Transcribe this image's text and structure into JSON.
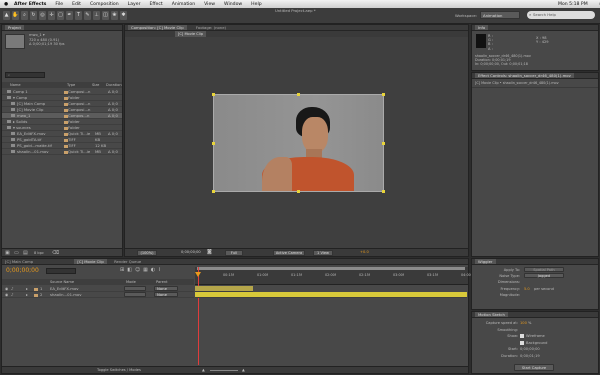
{
  "menubar": {
    "app": "After Effects",
    "items": [
      "File",
      "Edit",
      "Composition",
      "Layer",
      "Effect",
      "Animation",
      "View",
      "Window",
      "Help"
    ],
    "doc_title": "Untitled Project.aep *",
    "clock": "Mon 5:18 PM"
  },
  "toolbar": {
    "workspace_label": "Workspace:",
    "workspace_value": "Animation",
    "search_placeholder": "Search Help"
  },
  "project": {
    "tab": "Project",
    "file_name": "mwo_1 ▾",
    "file_dims": "720 x 480 (0.91)",
    "file_dur": "Δ 0;00;01;19 30 fps",
    "search_placeholder": "⌕",
    "headers": {
      "name": "Name",
      "type": "Type",
      "size": "Size",
      "duration": "Duration"
    },
    "items": [
      {
        "name": "Comp 1",
        "type": "Composi...n",
        "size": "",
        "dur": "Δ 0;0",
        "color": "#c9a06a",
        "indent": 0,
        "sel": false
      },
      {
        "name": "▾ Comp",
        "type": "Folder",
        "size": "",
        "dur": "",
        "color": "#c9a06a",
        "indent": 0,
        "sel": false
      },
      {
        "name": "[C] Main Comp",
        "type": "Composi...n",
        "size": "",
        "dur": "Δ 0;0",
        "color": "#c9a06a",
        "indent": 1,
        "sel": false
      },
      {
        "name": "[C] Movie Clip",
        "type": "Composi...n",
        "size": "",
        "dur": "Δ 0;0",
        "color": "#c9a06a",
        "indent": 1,
        "sel": false
      },
      {
        "name": "mwo_1",
        "type": "Compos...n",
        "size": "",
        "dur": "Δ 0;0",
        "color": "#c9a06a",
        "indent": 1,
        "sel": true
      },
      {
        "name": "▸ Solids",
        "type": "Folder",
        "size": "",
        "dur": "",
        "color": "#c9a06a",
        "indent": 0,
        "sel": false
      },
      {
        "name": "▾ sources",
        "type": "Folder",
        "size": "",
        "dur": "",
        "color": "#c9a06a",
        "indent": 0,
        "sel": false
      },
      {
        "name": "EA_EditFX.mov",
        "type": "Quick Ti...ie",
        "size": "MB",
        "dur": "Δ 0;0",
        "color": "#c9a06a",
        "indent": 1,
        "sel": false
      },
      {
        "name": "PS_goldTA.tif",
        "type": "TIFF",
        "size": "KB",
        "dur": "",
        "color": "#c9a06a",
        "indent": 1,
        "sel": false
      },
      {
        "name": "PS_gold...matte.tif",
        "type": "TIFF",
        "size": "12 KB",
        "dur": "",
        "color": "#c9a06a",
        "indent": 1,
        "sel": false
      },
      {
        "name": "shaolin...01.mov",
        "type": "Quick Ti...ie",
        "size": "MB",
        "dur": "Δ 0;0",
        "color": "#c9a06a",
        "indent": 1,
        "sel": false
      }
    ],
    "bpc": "8 bpc"
  },
  "comp": {
    "tab": "Composition: [C] Movie Clip",
    "tab2": "Footage: (none)",
    "subtab": "[C] Movie Clip",
    "zoom": "(100%)",
    "timecode": "0;00;00;00",
    "res": "Full",
    "camera": "Active Camera",
    "views": "1 View",
    "offset": "+0.0"
  },
  "info": {
    "tab": "Info",
    "r": "R :",
    "g": "G :",
    "b": "B :",
    "a": "A :",
    "x": "X : 98",
    "y": "Y : 429",
    "file": "shaolin_soccer_dr46_480(1).mov",
    "duration": "Duration: 0;00;01;19",
    "inout": "In: 0;00;00;00, Out: 0;00;01;18"
  },
  "effect_controls": {
    "tab": "Effect Controls: shaolin_soccer_dr46_480(1).mov",
    "sub": "[C] Movie Clip • shaolin_soccer_dr46_480(1).mov"
  },
  "timeline": {
    "tabs": [
      "[C] Main Comp",
      "[C] Movie Clip",
      "Render Queue"
    ],
    "timecode": "0;00;00;00",
    "headers": {
      "source": "Source Name",
      "mode": "Mode",
      "parent": "Parent"
    },
    "layers": [
      {
        "num": "1",
        "name": "EA_EditFX.mov",
        "mode": "None"
      },
      {
        "num": "2",
        "name": "shaolin...01.mov",
        "mode": "None"
      }
    ],
    "ticks": [
      "00:15f",
      "01:00f",
      "01:15f",
      "02:00f",
      "02:15f",
      "03:00f",
      "03:15f",
      "04:00f"
    ],
    "footer": "Toggle Switches / Modes"
  },
  "wiggler": {
    "tab": "Wiggler",
    "apply_to": "Apply To:",
    "apply_val": "Spatial Path",
    "noise_type": "Noise Type:",
    "noise_val": "Jagged",
    "dimensions": "Dimensions:",
    "frequency": "Frequency:",
    "freq_val": "5.0",
    "freq_unit": "per second",
    "magnitude": "Magnitude:"
  },
  "motion_sketch": {
    "tab": "Motion Sketch",
    "capture_speed": "Capture speed at:",
    "speed_val": "100",
    "speed_unit": "%",
    "smoothing": "Smoothing:",
    "show": "Show:",
    "wireframe": "Wireframe",
    "background": "Background",
    "start": "Start:",
    "start_val": "0;00;00;00",
    "duration": "Duration:",
    "duration_val": "0;00;01;19",
    "button": "Start Capture"
  },
  "colors": {
    "accent": "#e89a1c",
    "track": "#d8c93a",
    "workarea": "#8c8c8c"
  }
}
